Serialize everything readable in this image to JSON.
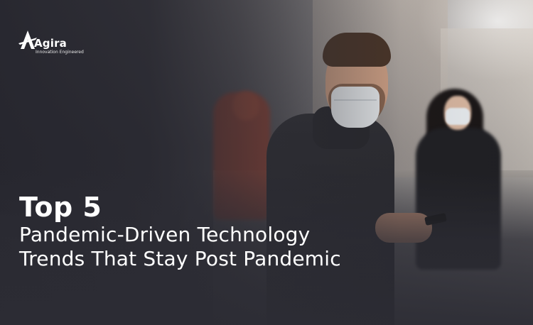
{
  "logo": {
    "name": "Agira",
    "tagline": "Innovation Engineered",
    "icon": "agira-logo-icon"
  },
  "headline": {
    "title": "Top 5",
    "subtitle_line1": "Pandemic-Driven Technology",
    "subtitle_line2": "Trends That Stay Post Pandemic"
  },
  "colors": {
    "text": "#ffffff",
    "overlay": "#2c2c34"
  }
}
